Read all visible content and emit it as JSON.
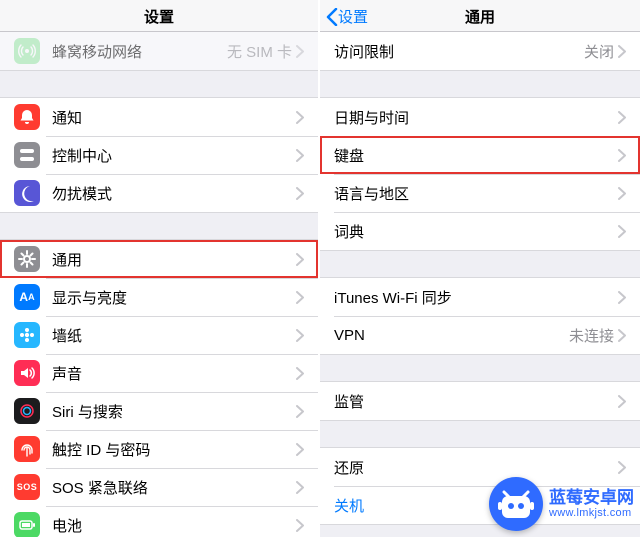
{
  "left": {
    "title": "设置",
    "groups": [
      {
        "cls": "first",
        "rows": [
          {
            "name": "cellular",
            "icon": "cellular-icon",
            "bg": "#4cd964",
            "label": "蜂窝移动网络",
            "value": "无 SIM 卡",
            "faded": true
          }
        ]
      },
      {
        "rows": [
          {
            "name": "notifications",
            "icon": "bell-icon",
            "bg": "#ff3b30",
            "label": "通知"
          },
          {
            "name": "control-center",
            "icon": "toggles-icon",
            "bg": "#8e8e93",
            "label": "控制中心"
          },
          {
            "name": "dnd",
            "icon": "moon-icon",
            "bg": "#5856d6",
            "label": "勿扰模式"
          }
        ]
      },
      {
        "rows": [
          {
            "name": "general",
            "icon": "gear-icon",
            "bg": "#8e8e93",
            "label": "通用",
            "highlight": true
          },
          {
            "name": "display",
            "icon": "display-icon",
            "bg": "#007aff",
            "label": "显示与亮度"
          },
          {
            "name": "wallpaper",
            "icon": "wallpaper-icon",
            "bg": "#26b7ff",
            "label": "墙纸"
          },
          {
            "name": "sounds",
            "icon": "sound-icon",
            "bg": "#ff2d55",
            "label": "声音"
          },
          {
            "name": "siri",
            "icon": "siri-icon",
            "bg": "#1c1c1e",
            "label": "Siri 与搜索"
          },
          {
            "name": "touchid",
            "icon": "fingerprint-icon",
            "bg": "#ff3b30",
            "label": "触控 ID 与密码"
          },
          {
            "name": "sos",
            "icon": "sos-icon",
            "bg": "#ff3b30",
            "label": "SOS 紧急联络"
          },
          {
            "name": "battery",
            "icon": "battery-icon",
            "bg": "#4cd964",
            "label": "电池"
          }
        ]
      }
    ]
  },
  "right": {
    "back": "设置",
    "title": "通用",
    "groups": [
      {
        "cls": "first",
        "rows": [
          {
            "name": "restrictions",
            "label": "访问限制",
            "value": "关闭"
          }
        ]
      },
      {
        "rows": [
          {
            "name": "datetime",
            "label": "日期与时间"
          },
          {
            "name": "keyboard",
            "label": "键盘",
            "highlight": true
          },
          {
            "name": "language",
            "label": "语言与地区"
          },
          {
            "name": "dictionary",
            "label": "词典"
          }
        ]
      },
      {
        "rows": [
          {
            "name": "itunes-wifi",
            "label": "iTunes Wi-Fi 同步"
          },
          {
            "name": "vpn",
            "label": "VPN",
            "value": "未连接"
          }
        ]
      },
      {
        "rows": [
          {
            "name": "regulatory",
            "label": "监管"
          }
        ]
      },
      {
        "rows": [
          {
            "name": "reset",
            "label": "还原"
          },
          {
            "name": "shutdown",
            "label": "关机",
            "link": true,
            "noChevron": true
          }
        ]
      }
    ]
  },
  "watermark": {
    "name": "蓝莓安卓网",
    "url": "www.lmkjst.com"
  },
  "icons": {
    "cellular-icon": "((•))",
    "bell-icon": "BELL",
    "toggles-icon": "CTRL",
    "moon-icon": "MOON",
    "gear-icon": "GEAR",
    "display-icon": "AA",
    "wallpaper-icon": "FLWR",
    "sound-icon": "SND",
    "siri-icon": "SIRI",
    "fingerprint-icon": "FP",
    "sos-icon": "SOS",
    "battery-icon": "BATT"
  }
}
